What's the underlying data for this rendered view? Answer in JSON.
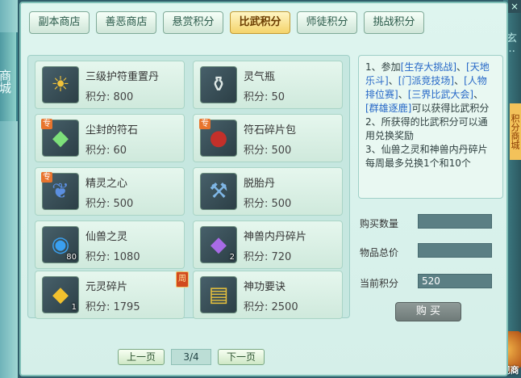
{
  "left_tab": {
    "label": "商城"
  },
  "right_side": {
    "text": "玄…",
    "tab": "积分商城",
    "close_glyph": "×",
    "exterior_label": "外观商"
  },
  "tabs": [
    {
      "label": "副本商店",
      "active": false
    },
    {
      "label": "善恶商店",
      "active": false
    },
    {
      "label": "悬赏积分",
      "active": false
    },
    {
      "label": "比武积分",
      "active": true
    },
    {
      "label": "师徒积分",
      "active": false
    },
    {
      "label": "挑战积分",
      "active": false
    }
  ],
  "items": [
    {
      "name": "三级护符重置丹",
      "points": "积分: 800",
      "icon": "amulet-icon",
      "glyph": "☀",
      "color": "#f0c23a",
      "zhuan": false,
      "count": ""
    },
    {
      "name": "灵气瓶",
      "points": "积分: 50",
      "icon": "vase-icon",
      "glyph": "⚱",
      "color": "#dfe9e6",
      "zhuan": false,
      "count": ""
    },
    {
      "name": "尘封的符石",
      "points": "积分: 60",
      "icon": "gem-icon",
      "glyph": "◆",
      "color": "#7de07a",
      "zhuan": true,
      "count": ""
    },
    {
      "name": "符石碎片包",
      "points": "积分: 500",
      "icon": "pouch-icon",
      "glyph": "●",
      "color": "#c4302a",
      "zhuan": true,
      "count": ""
    },
    {
      "name": "精灵之心",
      "points": "积分: 500",
      "icon": "heart-icon",
      "glyph": "❦",
      "color": "#5b8fe0",
      "zhuan": true,
      "count": ""
    },
    {
      "name": "脱胎丹",
      "points": "积分: 500",
      "icon": "hammer-icon",
      "glyph": "⚒",
      "color": "#7fb7e6",
      "zhuan": false,
      "count": ""
    },
    {
      "name": "仙兽之灵",
      "points": "积分: 1080",
      "icon": "orb-icon",
      "glyph": "◉",
      "color": "#3aa0f0",
      "zhuan": false,
      "count": "80"
    },
    {
      "name": "神兽内丹碎片",
      "points": "积分: 720",
      "icon": "crystal-icon",
      "glyph": "◆",
      "color": "#a86be6",
      "zhuan": false,
      "count": "2"
    },
    {
      "name": "元灵碎片",
      "points": "积分: 1795",
      "icon": "shard-icon",
      "glyph": "◆",
      "color": "#f2c12e",
      "zhuan": false,
      "count": "1",
      "week": "周"
    },
    {
      "name": "神功要诀",
      "points": "积分: 2500",
      "icon": "book-icon",
      "glyph": "▤",
      "color": "#e9c23c",
      "zhuan": false,
      "count": ""
    }
  ],
  "zhuan_label": "专",
  "pager": {
    "prev": "上一页",
    "page": "3/4",
    "next": "下一页"
  },
  "info": {
    "p1_a": "1、参加",
    "p1_hl1": "[生存大挑战]",
    "p1_b": "、",
    "p1_hl2": "[天地乐斗]",
    "p1_c": "、",
    "p1_hl3": "[门派竞技场]",
    "p1_d": "、",
    "p1_hl4": "[人物排位赛]",
    "p1_e": "、",
    "p1_hl5": "[三界比武大会]",
    "p1_f": "、",
    "p1_hl6": "[群雄逐鹿]",
    "p1_g": "可以获得比武积分",
    "p2": "2、所获得的比武积分可以通用兑换奖励",
    "p3": "3、仙兽之灵和神兽内丹碎片每周最多兑换1个和10个"
  },
  "form": {
    "qty_label": "购买数量",
    "qty_value": "",
    "total_label": "物品总价",
    "total_value": "",
    "current_label": "当前积分",
    "current_value": "520"
  },
  "buy_label": "购 买"
}
